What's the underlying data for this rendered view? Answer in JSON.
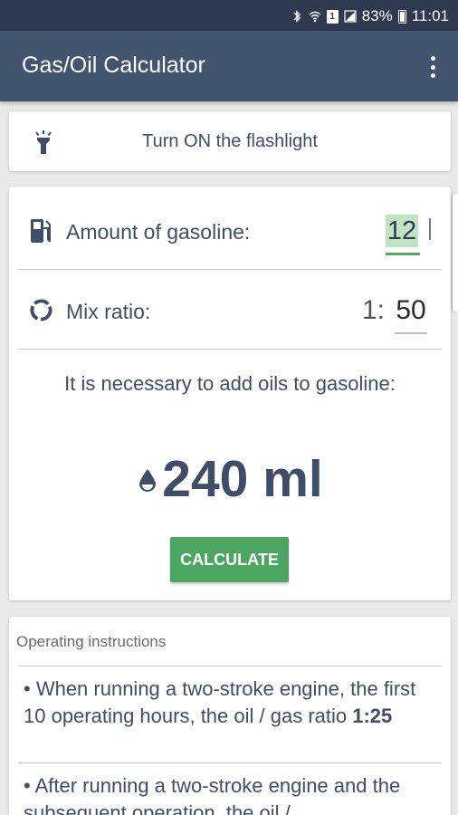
{
  "status_bar": {
    "battery_percent": "83%",
    "time": "11:01",
    "sim_label": "1",
    "icons": [
      "bluetooth-icon",
      "wifi-icon",
      "sim-icon",
      "signal-icon",
      "battery-icon"
    ]
  },
  "app": {
    "title": "Gas/Oil Calculator",
    "menu_icon": "more-vert-icon"
  },
  "flashlight": {
    "label": "Turn ON the flashlight",
    "icon": "flashlight-icon"
  },
  "calculator": {
    "amount_label": "Amount of gasoline:",
    "amount_value": "12",
    "ratio_label": "Mix ratio:",
    "ratio_prefix": "1:",
    "ratio_value": "50",
    "result_label": "It is necessary to add oils to gasoline:",
    "result_value": "240 ml",
    "button_label": "CALCULATE"
  },
  "operating": {
    "header": "Operating instructions",
    "item1_text": "• When running a two-stroke engine, the first 10 operating hours, the oil / gas ratio ",
    "item1_bold": "1:25",
    "item2_text": "• After running a two-stroke engine and the subsequent operation, the oil /"
  },
  "colors": {
    "app_bar": "#43546f",
    "status_bar": "#2f3a50",
    "accent_green": "#4da562",
    "text_primary": "#3f4d68"
  }
}
